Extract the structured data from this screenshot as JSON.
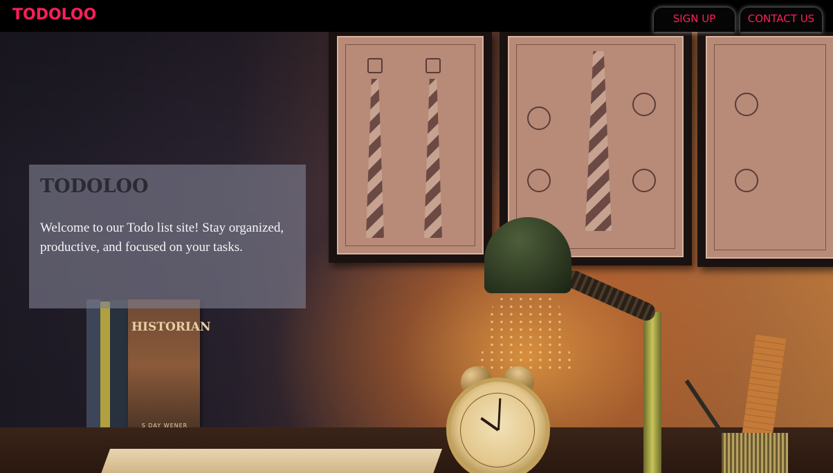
{
  "navbar": {
    "brand": "TODOLOO",
    "signup_label": "SIGN UP",
    "contact_label": "CONTACT US"
  },
  "hero": {
    "book_title": "HISTORIAN",
    "book_author": "S DAY WENER",
    "card_title": "TODOLOO",
    "card_text": "Welcome to our Todo list site! Stay organized, productive, and focused on your tasks."
  },
  "colors": {
    "accent": "#ff1f5a",
    "navbar_bg": "#000000",
    "card_bg": "#808092"
  },
  "icons": {
    "hero_image": "desk-lamp-clock-photo"
  }
}
